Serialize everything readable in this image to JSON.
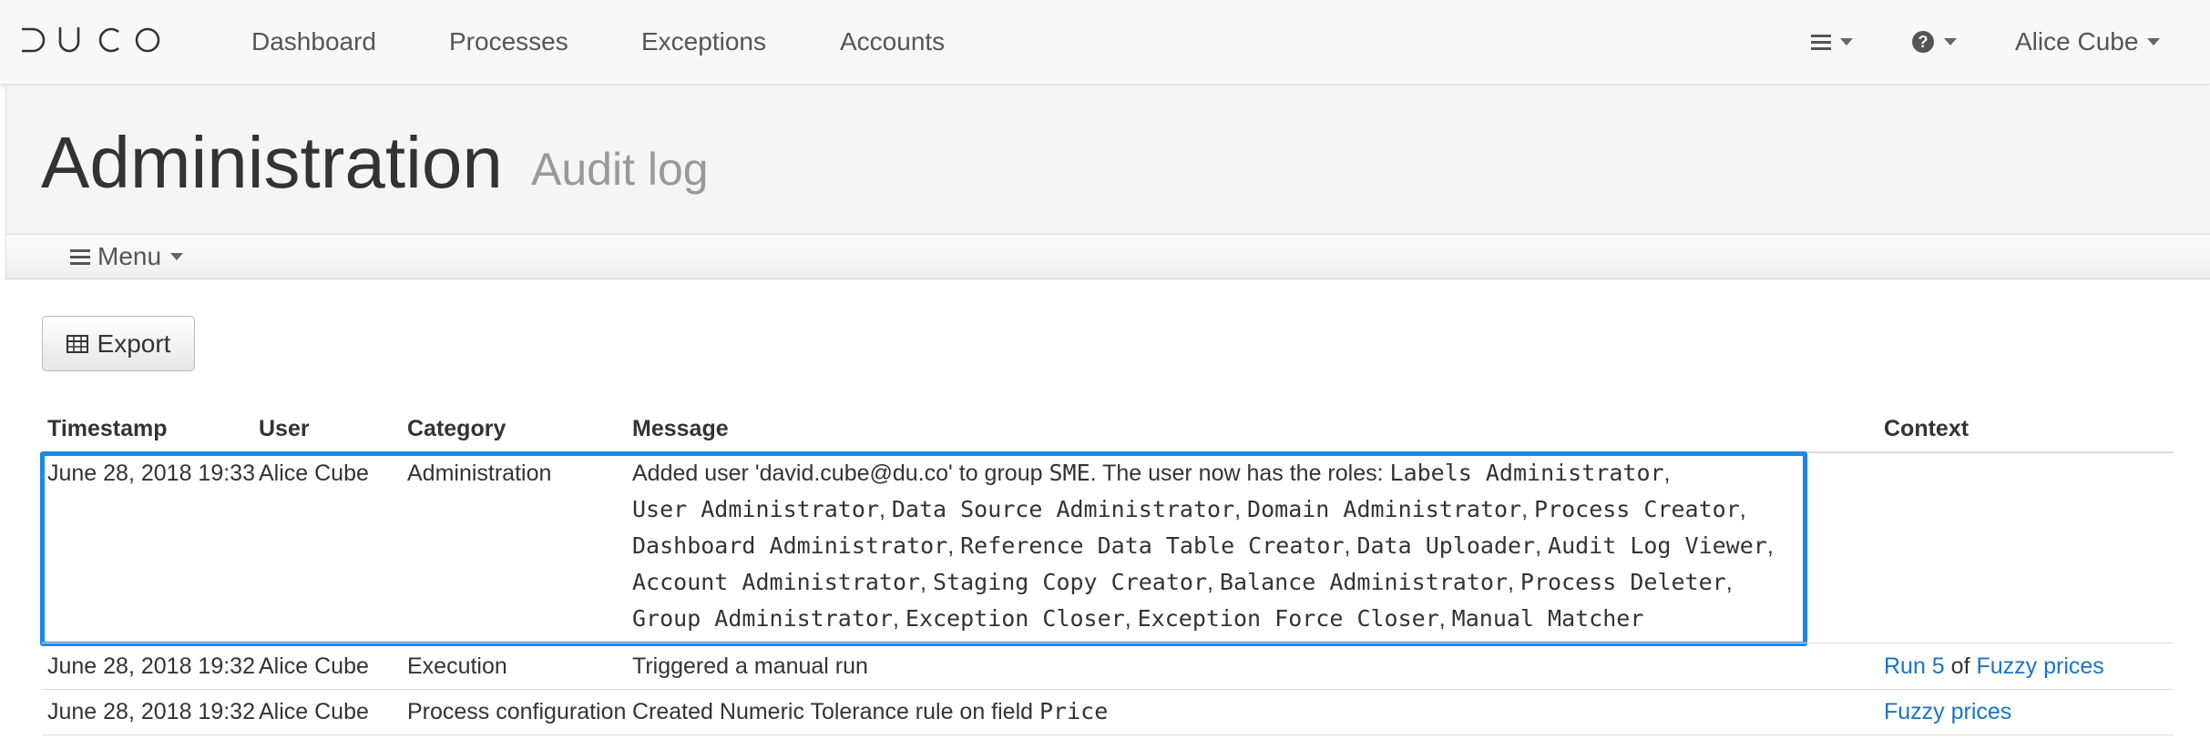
{
  "navbar": {
    "brand": "DUCO",
    "links": [
      "Dashboard",
      "Processes",
      "Exceptions",
      "Accounts"
    ],
    "user_name": "Alice Cube"
  },
  "header": {
    "title": "Administration",
    "subtitle": "Audit log"
  },
  "menu": {
    "label": "Menu"
  },
  "toolbar": {
    "export_label": "Export"
  },
  "table": {
    "columns": [
      "Timestamp",
      "User",
      "Category",
      "Message",
      "Context"
    ],
    "rows": [
      {
        "timestamp": "June 28, 2018 19:33",
        "user": "Alice Cube",
        "category": "Administration",
        "message_prefix": "Added user 'david.cube@du.co' to group",
        "group": "SME",
        "message_mid": ". The user now has the roles:",
        "roles": [
          "Labels Administrator",
          "User Administrator",
          "Data Source Administrator",
          "Domain Administrator",
          "Process Creator",
          "Dashboard Administrator",
          "Reference Data Table Creator",
          "Data Uploader",
          "Audit Log Viewer",
          "Account Administrator",
          "Staging Copy Creator",
          "Balance Administrator",
          "Process Deleter",
          "Group Administrator",
          "Exception Closer",
          "Exception Force Closer",
          "Manual Matcher"
        ]
      },
      {
        "timestamp": "June 28, 2018 19:32",
        "user": "Alice Cube",
        "category": "Execution",
        "message": "Triggered a manual run",
        "context_run": "Run 5",
        "context_of": "of",
        "context_process": "Fuzzy prices"
      },
      {
        "timestamp": "June 28, 2018 19:32",
        "user": "Alice Cube",
        "category": "Process configuration",
        "message": "Created Numeric Tolerance rule on field",
        "field": "Price",
        "context_process": "Fuzzy prices"
      }
    ]
  },
  "colors": {
    "accent": "#1e88e5",
    "link": "#1a73c7"
  }
}
